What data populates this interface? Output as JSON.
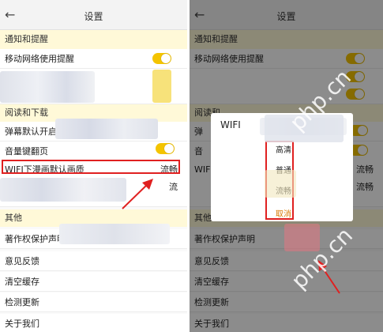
{
  "screen_title": "设置",
  "left": {
    "sections": {
      "notify": "通知和提醒",
      "read": "阅读和下载",
      "other": "其他"
    },
    "rows": {
      "mobile_reminder": "移动网络使用提醒",
      "popup": "弹幕默认开启",
      "volume_flip": "音量键翻页",
      "wifi_quality": "WIFI下漫画默认画质",
      "wifi_quality_value": "流畅",
      "partial_value": "流",
      "copyright": "著作权保护声明",
      "feedback": "意见反馈",
      "clear_cache": "清空缓存",
      "check_update": "检测更新",
      "about": "关于我们"
    }
  },
  "right": {
    "sections": {
      "notify": "通知和提醒",
      "read": "阅读和",
      "other": "其他"
    },
    "rows": {
      "mobile_reminder": "移动网络使用提醒",
      "row_pop": "弹",
      "row_vol": "音",
      "row_wifi": "WIFI",
      "wifi_value": "流畅",
      "partial_value": "流畅",
      "copyright": "著作权保护声明",
      "feedback": "意见反馈",
      "clear_cache": "清空缓存",
      "check_update": "检测更新",
      "about": "关于我们"
    },
    "dialog": {
      "title": "WIFI",
      "options": [
        "高清",
        "普通",
        "流畅"
      ],
      "cancel": "取消"
    }
  },
  "watermark": "php.cn",
  "colors": {
    "accent_yellow": "#f4c400",
    "section_bg": "#fff9d8",
    "highlight_red": "#e02020",
    "cancel_orange": "#d97a00"
  }
}
